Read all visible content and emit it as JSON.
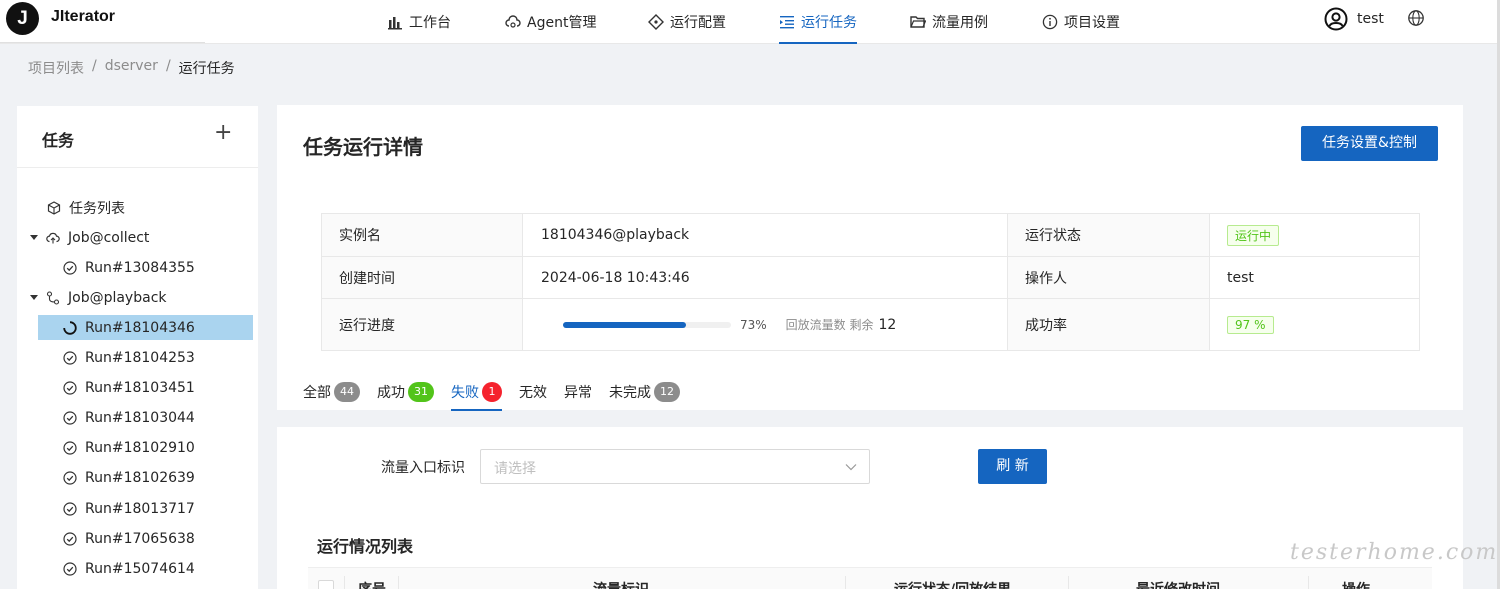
{
  "brand": {
    "logo_letter": "J",
    "name": "JIterator"
  },
  "nav": [
    {
      "label": "工作台",
      "icon": "bar-chart-icon"
    },
    {
      "label": "Agent管理",
      "icon": "cloud-cog-icon"
    },
    {
      "label": "运行配置",
      "icon": "diamond-icon"
    },
    {
      "label": "运行任务",
      "icon": "task-list-icon",
      "active": true
    },
    {
      "label": "流量用例",
      "icon": "folder-open-icon"
    },
    {
      "label": "项目设置",
      "icon": "info-icon"
    }
  ],
  "user": {
    "name": "test"
  },
  "breadcrumb": {
    "root": "项目列表",
    "sep1": "/",
    "project": "dserver",
    "sep2": "/",
    "current": "运行任务"
  },
  "sidebar": {
    "title": "任务",
    "add": "+",
    "items": [
      {
        "label": "任务列表"
      },
      {
        "label": "Job@collect"
      },
      {
        "label": "Run#13084355"
      },
      {
        "label": "Job@playback"
      },
      {
        "label": "Run#18104346",
        "selected": true
      },
      {
        "label": "Run#18104253"
      },
      {
        "label": "Run#18103451"
      },
      {
        "label": "Run#18103044"
      },
      {
        "label": "Run#18102910"
      },
      {
        "label": "Run#18102639"
      },
      {
        "label": "Run#18013717"
      },
      {
        "label": "Run#17065638"
      },
      {
        "label": "Run#15074614"
      }
    ]
  },
  "detail": {
    "title": "任务运行详情",
    "settings_button": "任务设置&控制",
    "rows": {
      "instance_label": "实例名",
      "instance_value": "18104346@playback",
      "status_label": "运行状态",
      "status_value": "运行中",
      "created_label": "创建时间",
      "created_value": "2024-06-18 10:43:46",
      "operator_label": "操作人",
      "operator_value": "test",
      "progress_label": "运行进度",
      "progress_value": 73,
      "progress_text": "73%",
      "remaining_label": "回放流量数 剩余",
      "remaining_value": "12",
      "success_label": "成功率",
      "success_value": "97 %"
    },
    "tabs": [
      {
        "label": "全部",
        "count": "44",
        "color": "#8c8c8c"
      },
      {
        "label": "成功",
        "count": "31",
        "color": "#52c41a"
      },
      {
        "label": "失败",
        "count": "1",
        "color": "#f5222d",
        "active": true
      },
      {
        "label": "无效"
      },
      {
        "label": "异常"
      },
      {
        "label": "未完成",
        "count": "12",
        "color": "#8c8c8c"
      }
    ]
  },
  "filter": {
    "label": "流量入口标识",
    "placeholder": "请选择",
    "refresh": "刷 新",
    "list_title": "运行情况列表",
    "columns": [
      "序号",
      "流量标识",
      "运行状态/回放结果",
      "最近修改时间",
      "操作"
    ]
  },
  "watermark": "testerhome.com",
  "colors": {
    "primary": "#1565c0",
    "success": "#52c41a",
    "danger": "#f5222d"
  }
}
